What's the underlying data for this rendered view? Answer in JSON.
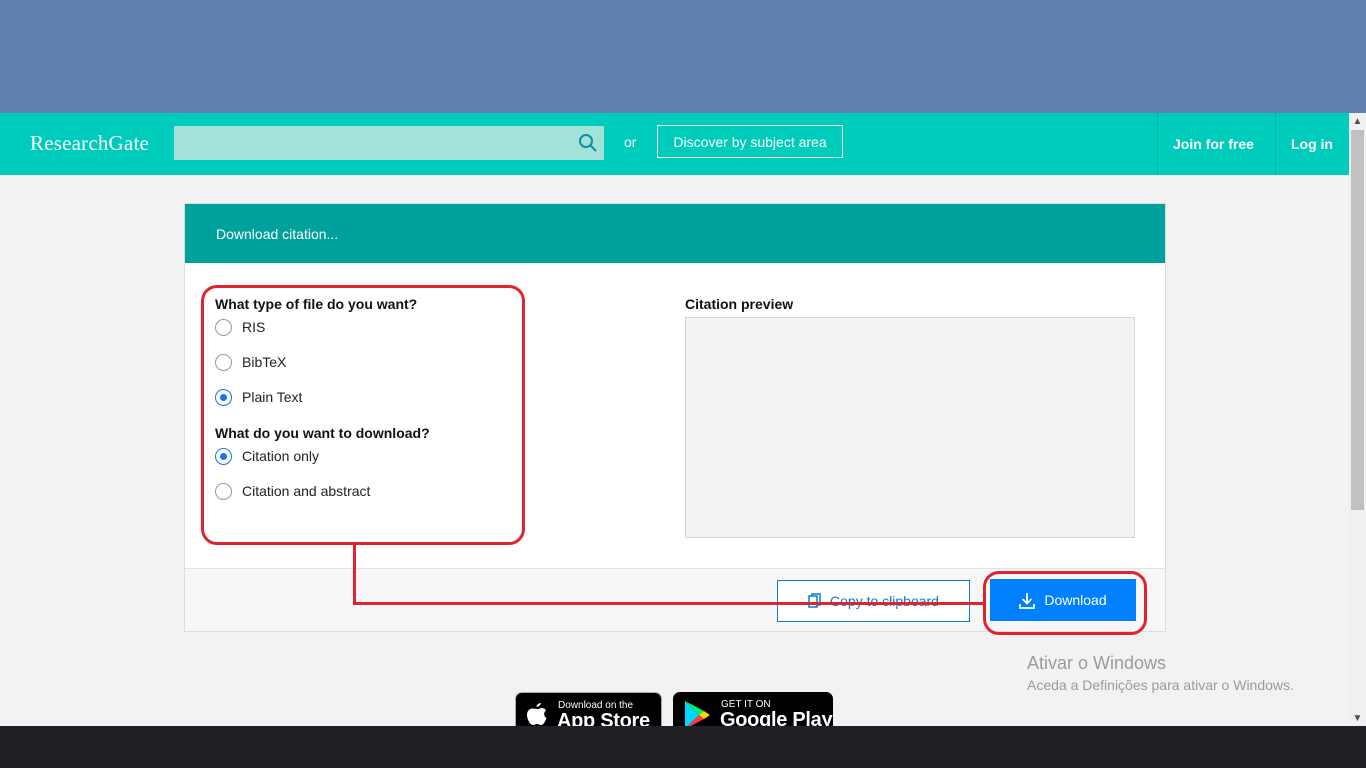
{
  "header": {
    "logo": "ResearchGate",
    "search": {
      "value": "",
      "placeholder": ""
    },
    "or_text": "or",
    "discover_label": "Discover by subject area",
    "join_label": "Join for free",
    "login_label": "Log in"
  },
  "modal": {
    "title": "Download citation...",
    "file_type_heading": "What type of file do you want?",
    "file_types": [
      {
        "label": "RIS",
        "checked": false
      },
      {
        "label": "BibTeX",
        "checked": false
      },
      {
        "label": "Plain Text",
        "checked": true
      }
    ],
    "download_heading": "What do you want to download?",
    "download_options": [
      {
        "label": "Citation only",
        "checked": true
      },
      {
        "label": "Citation and abstract",
        "checked": false
      }
    ],
    "preview_heading": "Citation preview",
    "preview_text": "",
    "copy_label": "Copy to clipboard",
    "download_label": "Download"
  },
  "badges": {
    "apple_small": "Download on the",
    "apple_big": "App Store",
    "google_small": "GET IT ON",
    "google_big": "Google Play"
  },
  "watermark": {
    "title": "Ativar o Windows",
    "subtitle": "Aceda a Definições para ativar o Windows."
  },
  "colors": {
    "top_band": "#5f80b0",
    "navbar": "#00ccbb",
    "modal_header": "#00a19a",
    "primary": "#0080ff",
    "annotation": "#e0242f"
  }
}
